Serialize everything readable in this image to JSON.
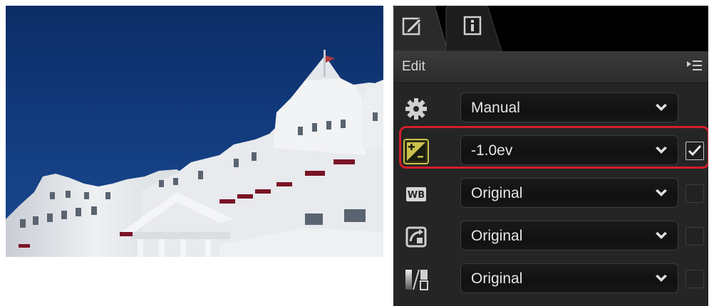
{
  "tabs": [
    {
      "name": "edit-tab",
      "icon": "edit-brush-icon",
      "active": true
    },
    {
      "name": "info-tab",
      "icon": "info-icon",
      "active": false
    }
  ],
  "edit_bar": {
    "label": "Edit",
    "menu_icon": "panel-menu-icon"
  },
  "rows": [
    {
      "icon": "gear-icon",
      "value": "Manual",
      "checkbox": null
    },
    {
      "icon": "exposure-compensation-icon",
      "value": "-1.0ev",
      "checkbox": true,
      "highlighted": true
    },
    {
      "icon": "white-balance-icon",
      "value": "Original",
      "checkbox": false,
      "icon_text": "WB"
    },
    {
      "icon": "picture-control-icon",
      "value": "Original",
      "checkbox": false
    },
    {
      "icon": "tone-adjust-icon",
      "value": "Original",
      "checkbox": false
    }
  ],
  "colors": {
    "highlight": "#d21f2b",
    "panel_bg": "#252525",
    "sky": "#123a7c",
    "active_icon": "#c9c24a"
  }
}
